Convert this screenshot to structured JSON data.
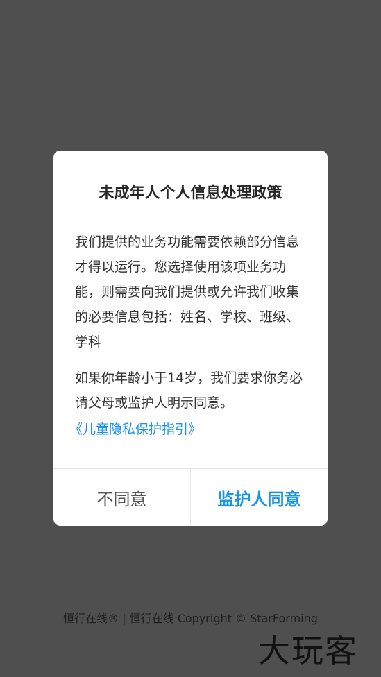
{
  "dialog": {
    "title": "未成年人个人信息处理政策",
    "paragraph_1": "我们提供的业务功能需要依赖部分信息才得以运行。您选择使用该项业务功能，则需要向我们提供或允许我们收集的必要信息包括：姓名、学校、班级、学科",
    "paragraph_2": "如果你年龄小于14岁，我们要求你务必请父母或监护人明示同意。",
    "policy_link": "《儿童隐私保护指引》",
    "disagree_label": "不同意",
    "agree_label": "监护人同意"
  },
  "footer": {
    "text": "恒行在线® | 恒行在线 Copyright © StarForming"
  },
  "watermark": {
    "text": "大玩客"
  },
  "colors": {
    "overlay": "#4f4f4f",
    "accent": "#1a94e8",
    "dialog_bg": "#ffffff"
  }
}
